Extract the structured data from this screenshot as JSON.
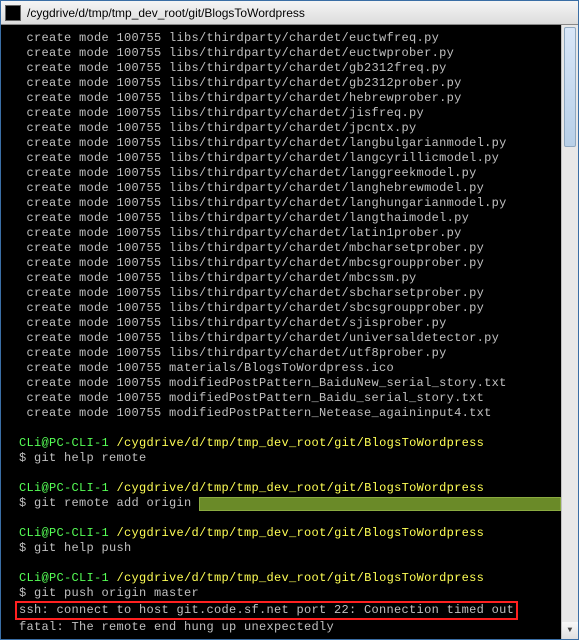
{
  "titlebar": {
    "text": "/cygdrive/d/tmp/tmp_dev_root/git/BlogsToWordpress"
  },
  "create_lines": [
    "create mode 100755 libs/thirdparty/chardet/euctwfreq.py",
    "create mode 100755 libs/thirdparty/chardet/euctwprober.py",
    "create mode 100755 libs/thirdparty/chardet/gb2312freq.py",
    "create mode 100755 libs/thirdparty/chardet/gb2312prober.py",
    "create mode 100755 libs/thirdparty/chardet/hebrewprober.py",
    "create mode 100755 libs/thirdparty/chardet/jisfreq.py",
    "create mode 100755 libs/thirdparty/chardet/jpcntx.py",
    "create mode 100755 libs/thirdparty/chardet/langbulgarianmodel.py",
    "create mode 100755 libs/thirdparty/chardet/langcyrillicmodel.py",
    "create mode 100755 libs/thirdparty/chardet/langgreekmodel.py",
    "create mode 100755 libs/thirdparty/chardet/langhebrewmodel.py",
    "create mode 100755 libs/thirdparty/chardet/langhungarianmodel.py",
    "create mode 100755 libs/thirdparty/chardet/langthaimodel.py",
    "create mode 100755 libs/thirdparty/chardet/latin1prober.py",
    "create mode 100755 libs/thirdparty/chardet/mbcharsetprober.py",
    "create mode 100755 libs/thirdparty/chardet/mbcsgroupprober.py",
    "create mode 100755 libs/thirdparty/chardet/mbcssm.py",
    "create mode 100755 libs/thirdparty/chardet/sbcharsetprober.py",
    "create mode 100755 libs/thirdparty/chardet/sbcsgroupprober.py",
    "create mode 100755 libs/thirdparty/chardet/sjisprober.py",
    "create mode 100755 libs/thirdparty/chardet/universaldetector.py",
    "create mode 100755 libs/thirdparty/chardet/utf8prober.py",
    "create mode 100755 materials/BlogsToWordpress.ico",
    "create mode 100755 modifiedPostPattern_BaiduNew_serial_story.txt",
    "create mode 100755 modifiedPostPattern_Baidu_serial_story.txt",
    "create mode 100755 modifiedPostPattern_Netease_againinput4.txt"
  ],
  "prompt": {
    "user": "CLi@PC-CLI-1",
    "path": "/cygdrive/d/tmp/tmp_dev_root/git/BlogsToWordpress",
    "dollar": "$ "
  },
  "commands": {
    "c1": "git help remote",
    "c2": "git remote add origin ",
    "c3": "git help push",
    "c4": "git push origin master"
  },
  "error": {
    "ssh": "ssh: connect to host git.code.sf.net port 22: Connection timed out",
    "fatal": "fatal: The remote end hung up unexpectedly"
  }
}
